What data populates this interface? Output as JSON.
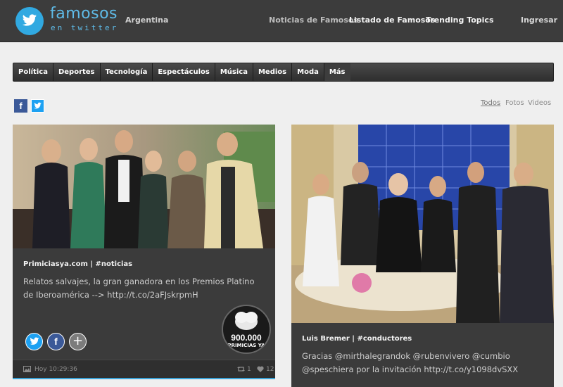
{
  "header": {
    "logo_title": "famosos",
    "logo_subtitle": "en twitter",
    "country": "Argentina",
    "nav": [
      "Noticias de Famosos",
      "Listado de Famosos",
      "Trending Topics"
    ],
    "login": "Ingresar"
  },
  "categories": [
    "Política",
    "Deportes",
    "Tecnología",
    "Espectáculos",
    "Música",
    "Medios",
    "Moda",
    "Más"
  ],
  "share": {
    "facebook_glyph": "f"
  },
  "filters": [
    "Todos",
    "Fotos",
    "Videos"
  ],
  "cards": [
    {
      "source": "Primiciasya.com | #noticias",
      "text": "Relatos salvajes, la gran ganadora en los Premios Platino de Iberoamérica --> http://t.co/2aFJskrpmH",
      "badge_number": "900.000",
      "badge_source": "PRIMICIAS YA",
      "time": "Hoy 10:29:36",
      "retweets": "1",
      "favorites": "12",
      "social_more": "+"
    },
    {
      "source": "Luis Bremer | #conductores",
      "text": "Gracias @mirthalegrandok @rubenvivero @cumbio @speschiera por la invitación http://t.co/y1098dvSXX"
    }
  ],
  "colors": {
    "topbar": "#3c3c3c",
    "brand_blue": "#5fbce9",
    "twitter_blue": "#1da1f2",
    "facebook_blue": "#3b5998",
    "card_bg": "#3b3b3b",
    "page_bg": "#efefef"
  }
}
